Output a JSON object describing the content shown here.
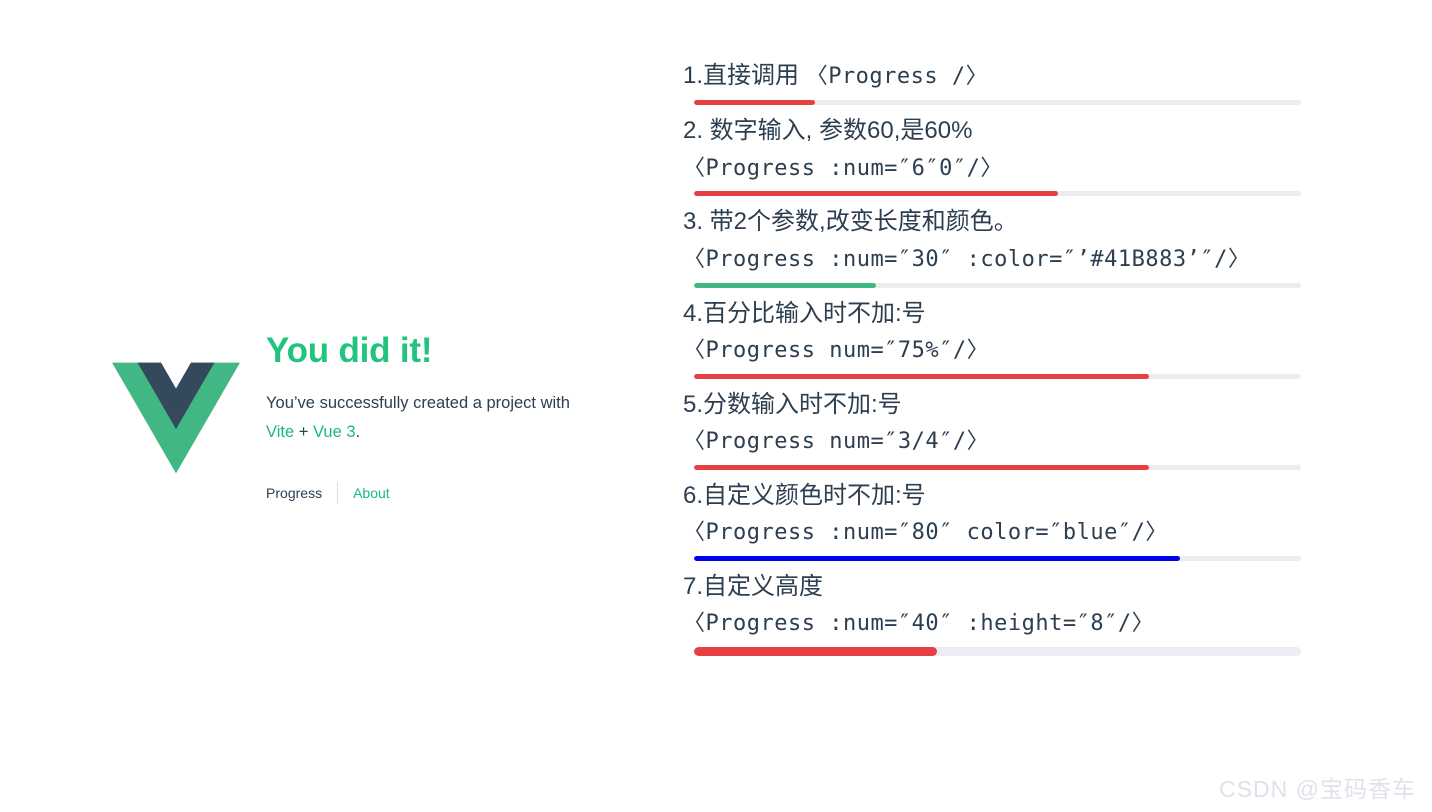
{
  "hero": {
    "logo_alt": "vue-logo",
    "heading": "You did it!",
    "message_prefix": "You’ve successfully created a project with",
    "link_vite": "Vite",
    "plus": "+",
    "link_vue": "Vue 3",
    "period": ".",
    "nav": {
      "progress": "Progress",
      "about": "About"
    },
    "colors": {
      "vue_green": "#41b883",
      "vue_dark": "#35495e",
      "heading_green": "#22c47d",
      "link_green": "#18b981"
    }
  },
  "demo": {
    "track_color": "#ebedf2",
    "items": [
      {
        "title": "1.直接调用 ",
        "title_code": "〈Progress /〉",
        "code": "",
        "bar": {
          "percent": 20,
          "color": "#e84040",
          "height": 5
        }
      },
      {
        "title": "2. 数字输入, 参数60,是60%",
        "title_code": "",
        "code": "〈Progress :num=″6⁠″0″/〉",
        "bar": {
          "percent": 60,
          "color": "#e84040",
          "height": 5
        }
      },
      {
        "title": "3. 带2个参数,改变长度和颜色。",
        "title_code": "",
        "code": "〈Progress :num=″30″ :color=″’#41B883’″/〉",
        "bar": {
          "percent": 30,
          "color": "#41b883",
          "height": 5
        }
      },
      {
        "title": "4.百分比输入时不加:号",
        "title_code": "",
        "code": "〈Progress num=″75%″/〉",
        "bar": {
          "percent": 75,
          "color": "#e84040",
          "height": 5
        }
      },
      {
        "title": "5.分数输入时不加:号",
        "title_code": "",
        "code": "〈Progress num=″3/4″/〉",
        "bar": {
          "percent": 75,
          "color": "#e84040",
          "height": 5
        }
      },
      {
        "title": "6.自定义颜色时不加:号",
        "title_code": "",
        "code": "〈Progress :num=″80″ color=″blue″/〉",
        "bar": {
          "percent": 80,
          "color": "#0000ee",
          "height": 5
        }
      },
      {
        "title": "7.自定义高度",
        "title_code": "",
        "code": "〈Progress :num=″40″ :height=″8″/〉",
        "bar": {
          "percent": 40,
          "color": "#e84040",
          "height": 9
        }
      }
    ]
  },
  "watermark": "CSDN @宝码香车"
}
